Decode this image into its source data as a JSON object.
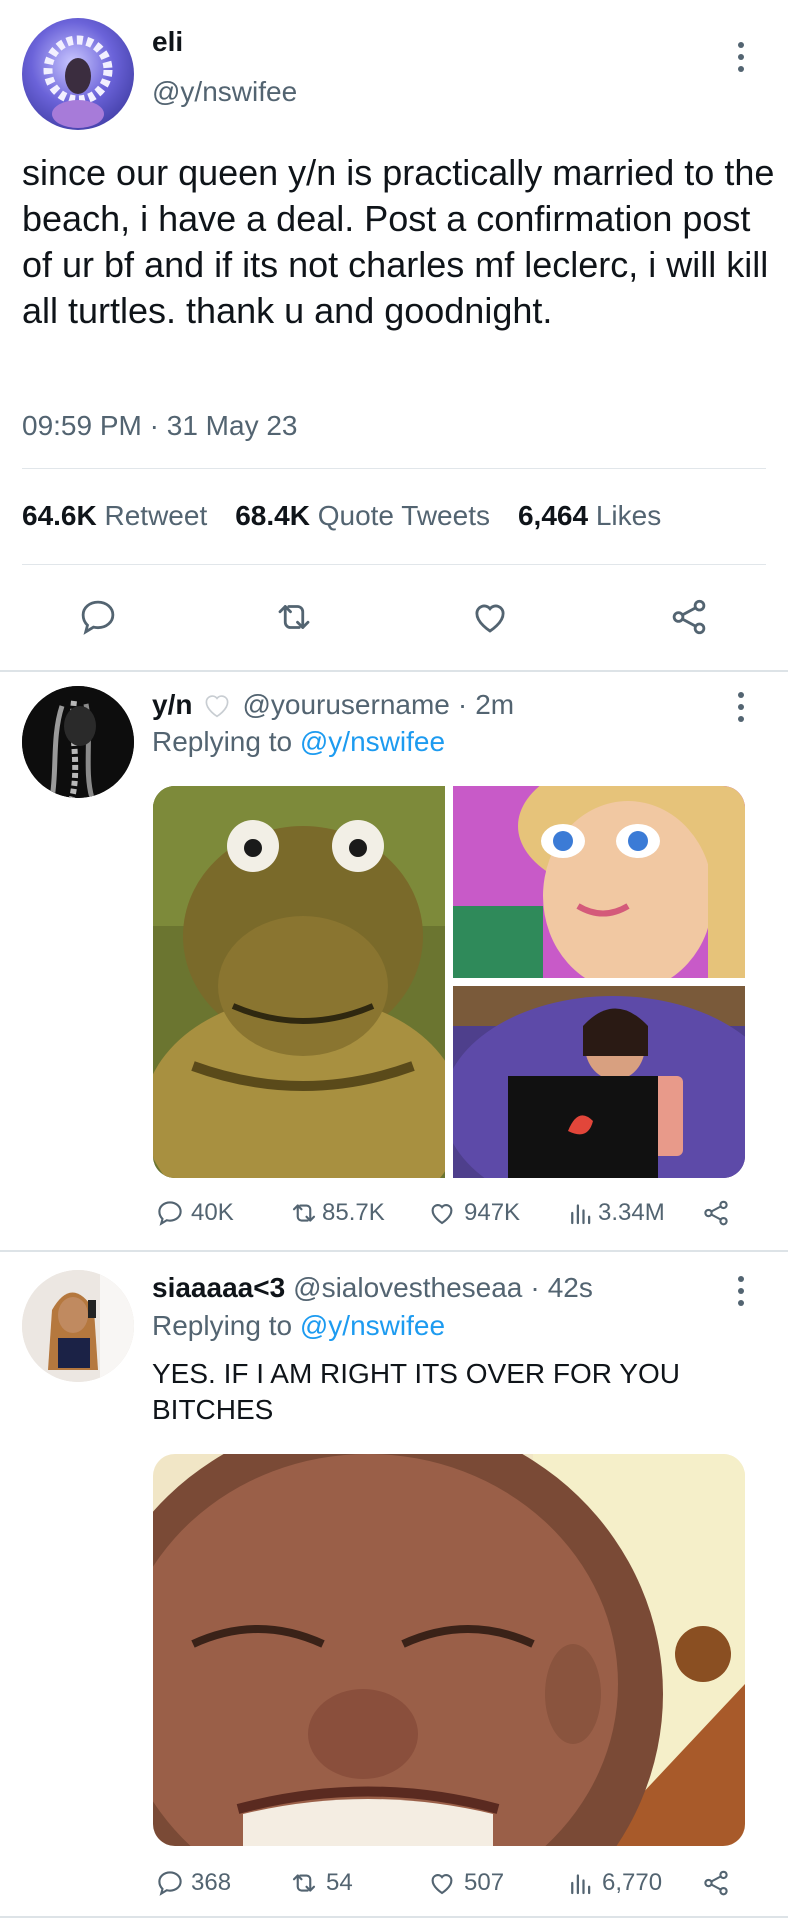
{
  "main_tweet": {
    "display_name": "eli",
    "handle": "@y/nswifee",
    "text": "since our queen y/n is practically married to the beach, i have a deal. Post a confirmation post of ur bf and if its not charles mf leclerc, i will kill all turtles. thank u and goodnight.",
    "time": "09:59 PM",
    "separator": "·",
    "date": "31 May 23",
    "stats": [
      {
        "count": "64.6K",
        "label": "Retweet"
      },
      {
        "count": "68.4K",
        "label": "Quote Tweets"
      },
      {
        "count": "6,464",
        "label": "Likes"
      }
    ],
    "actions": [
      "reply-icon",
      "retweet-icon",
      "like-icon",
      "share-icon"
    ]
  },
  "replies": [
    {
      "display_name": "y/n",
      "badge": "white-heart-icon",
      "handle": "@yourusername",
      "dot": "·",
      "time": "2m",
      "replying_prefix": "Replying to",
      "replying_to": "@y/nswifee",
      "text": "",
      "media": [
        "turtle-image",
        "doll-image",
        "girl-laptop-image"
      ],
      "counts": {
        "replies": "40K",
        "retweets": "85.7K",
        "likes": "947K",
        "views": "3.34M"
      }
    },
    {
      "display_name": "siaaaaa<3",
      "handle": "@sialovestheseaa",
      "dot": "·",
      "time": "42s",
      "replying_prefix": "Replying to",
      "replying_to": "@y/nswifee",
      "text": "YES. IF I AM RIGHT ITS OVER FOR YOU BITCHES",
      "media": [
        "smiling-kid-image"
      ],
      "counts": {
        "replies": "368",
        "retweets": "54",
        "likes": "507",
        "views": "6,770"
      }
    }
  ],
  "colors": {
    "text": "#0f1419",
    "secondary": "#536471",
    "link": "#1d9bf0",
    "divider": "#e1e6ea"
  }
}
